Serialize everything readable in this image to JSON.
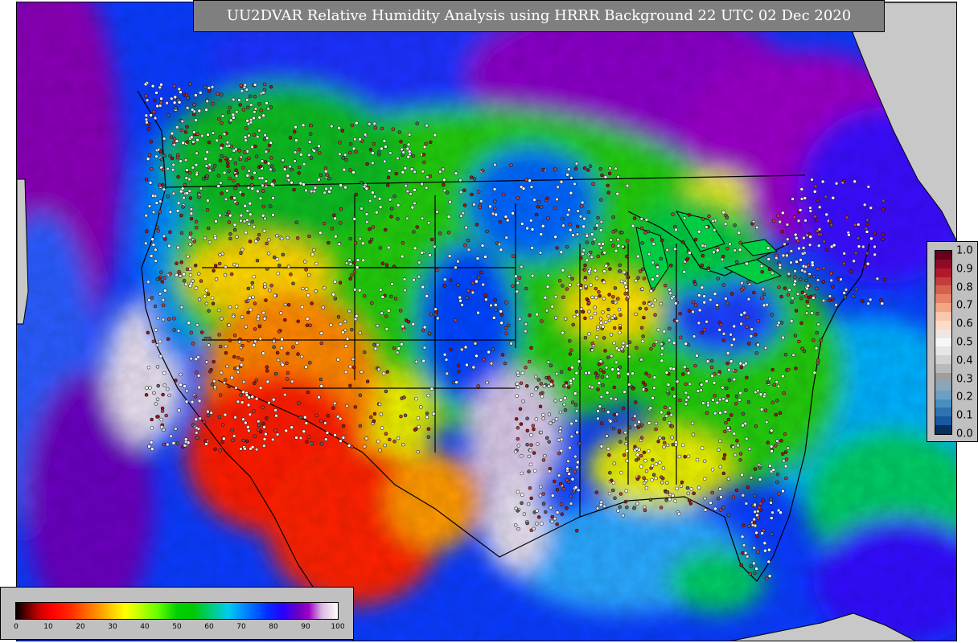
{
  "title": "UU2DVAR Relative Humidity Analysis using HRRR Background 22 UTC 02 Dec 2020",
  "rh_colorbar": {
    "ticks": [
      "0",
      "10",
      "20",
      "30",
      "40",
      "50",
      "60",
      "70",
      "80",
      "90",
      "100"
    ],
    "range": [
      0,
      100
    ]
  },
  "qc_colorbar": {
    "ticks": [
      "1.0",
      "0.9",
      "0.8",
      "0.7",
      "0.6",
      "0.5",
      "0.4",
      "0.3",
      "0.2",
      "0.1",
      "0.0"
    ],
    "range": [
      0.0,
      1.0
    ],
    "colors": [
      "#67001f",
      "#8e0b26",
      "#b2182b",
      "#c43c3c",
      "#d6604d",
      "#e58368",
      "#f4a582",
      "#f8c7ad",
      "#fddbc7",
      "#f0e6e2",
      "#f7f7f7",
      "#e6e6e6",
      "#d1d1d1",
      "#b9b9b9",
      "#9e9e9e",
      "#8aa6b8",
      "#6ba0c4",
      "#4a8ec0",
      "#2c74b0",
      "#18599e",
      "#053061"
    ]
  },
  "colors": {
    "ocean_purple": "#8a00b8",
    "ocean_blue": "#0040ff",
    "moist_blue": "#00aaff",
    "green": "#00cc00",
    "yellow": "#ffee00",
    "orange": "#ff8800",
    "red": "#ff0000",
    "land_gray": "#c8c8c8",
    "panel_gray": "#c0c0c0",
    "title_bg": "#7f7f7f"
  }
}
